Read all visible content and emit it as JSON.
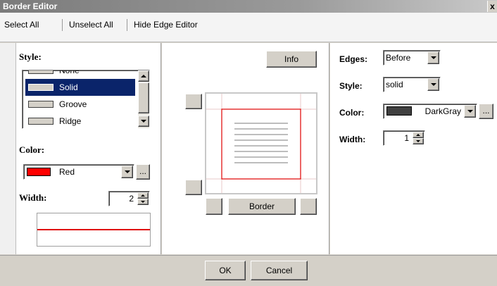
{
  "window": {
    "title": "Border Editor",
    "close_label": "x"
  },
  "menu": {
    "select_all": "Select All",
    "unselect_all": "Unselect All",
    "hide_edge_editor": "Hide Edge Editor"
  },
  "left": {
    "style_label": "Style:",
    "styles": [
      "None",
      "Solid",
      "Groove",
      "Ridge"
    ],
    "selected_style": "Solid",
    "color_label": "Color:",
    "color_value": "Red",
    "color_swatch": "#ff0000",
    "width_label": "Width:",
    "width_value": "2",
    "preview_line_color": "#e00000",
    "more_label": "..."
  },
  "middle": {
    "info_label": "Info",
    "border_label": "Border",
    "accent_color": "#e00000"
  },
  "right": {
    "edges_label": "Edges:",
    "edges_value": "Before",
    "style_label": "Style:",
    "style_value": "solid",
    "color_label": "Color:",
    "color_value": "DarkGray",
    "color_swatch": "#404040",
    "width_label": "Width:",
    "width_value": "1",
    "more_label": "..."
  },
  "footer": {
    "ok_label": "OK",
    "cancel_label": "Cancel"
  }
}
